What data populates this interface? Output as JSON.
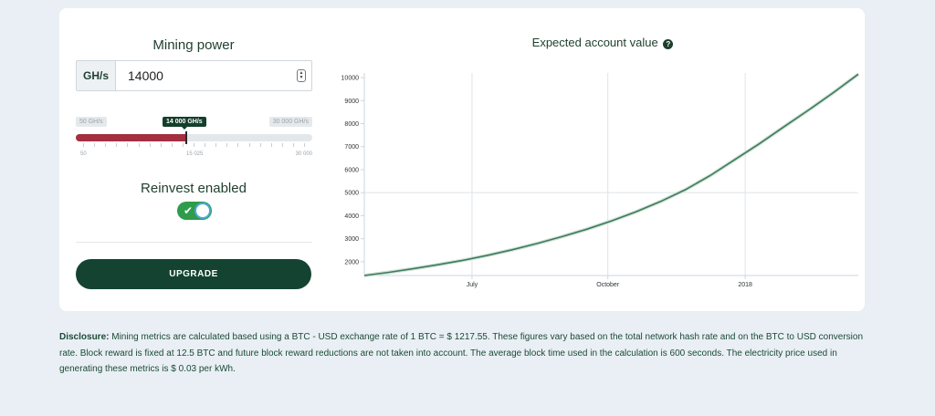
{
  "mining_power": {
    "title": "Mining power",
    "unit": "GH/s",
    "value": "14000",
    "slider": {
      "min_label": "50 GH/s",
      "max_label": "30 000 GH/s",
      "current_label": "14 000 GH/s",
      "min": 50,
      "max": 30000,
      "current": 14000,
      "tick_labels": [
        "50",
        "15 025",
        "30 000"
      ]
    }
  },
  "reinvest": {
    "label": "Reinvest enabled",
    "enabled": true
  },
  "upgrade_label": "UPGRADE",
  "chart": {
    "title": "Expected account value",
    "help_glyph": "?"
  },
  "chart_data": {
    "type": "line",
    "title": "Expected account value",
    "x_ticks": [
      "July",
      "October",
      "2018"
    ],
    "x_tick_positions": [
      0.218,
      0.493,
      0.771
    ],
    "x_range": [
      0,
      1
    ],
    "ylim": [
      1400,
      10200
    ],
    "y_ticks": [
      2000,
      3000,
      4000,
      5000,
      6000,
      7000,
      8000,
      9000,
      10000
    ],
    "grid": true,
    "line_color": "#3f7a5e",
    "series": [
      {
        "x": [
          0,
          0.05,
          0.1,
          0.15,
          0.2,
          0.25,
          0.3,
          0.35,
          0.4,
          0.45,
          0.5,
          0.55,
          0.6,
          0.65,
          0.7,
          0.75,
          0.8,
          0.85,
          0.9,
          0.95,
          1.0
        ],
        "values": [
          1400,
          1540,
          1700,
          1870,
          2060,
          2280,
          2520,
          2790,
          3090,
          3410,
          3770,
          4170,
          4620,
          5130,
          5740,
          6440,
          7130,
          7870,
          8600,
          9350,
          10150
        ]
      }
    ]
  },
  "disclosure": {
    "label": "Disclosure:",
    "text": " Mining metrics are calculated based using a BTC - USD exchange rate of 1 BTC = $ 1217.55. These figures vary based on the total network hash rate and on the BTC to USD conversion rate. Block reward is fixed at 12.5 BTC and future block reward reductions are not taken into account. The average block time used in the calculation is 600 seconds. The electricity price used in generating these metrics is $ 0.03 per kWh."
  }
}
